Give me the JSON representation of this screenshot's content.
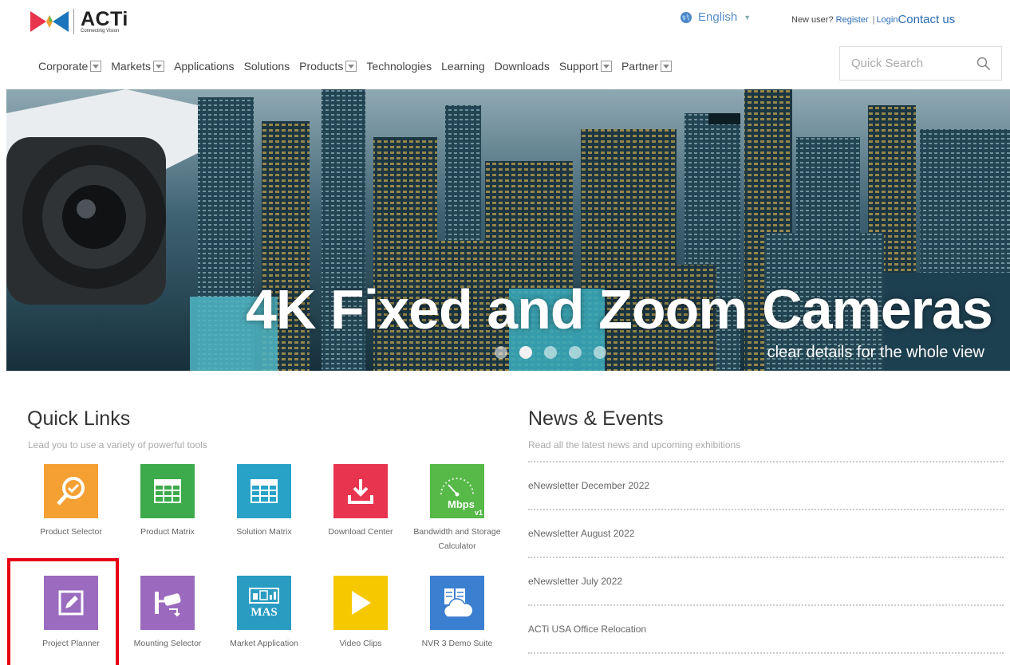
{
  "header": {
    "logo_text": "ACTi",
    "logo_tagline": "Connecting Vision",
    "language": "English",
    "new_user": "New user?",
    "register": "Register",
    "separator": "|",
    "login": "Login",
    "contact": "Contact us"
  },
  "nav": {
    "items": [
      {
        "label": "Corporate",
        "dropdown": true
      },
      {
        "label": "Markets",
        "dropdown": true
      },
      {
        "label": "Applications",
        "dropdown": false
      },
      {
        "label": "Solutions",
        "dropdown": false
      },
      {
        "label": "Products",
        "dropdown": true
      },
      {
        "label": "Technologies",
        "dropdown": false
      },
      {
        "label": "Learning",
        "dropdown": false
      },
      {
        "label": "Downloads",
        "dropdown": false
      },
      {
        "label": "Support",
        "dropdown": true
      },
      {
        "label": "Partner",
        "dropdown": true
      }
    ],
    "search_placeholder": "Quick Search"
  },
  "banner": {
    "title": "4K Fixed and Zoom Cameras",
    "subtitle": "clear details for the whole view",
    "slide_count": 5,
    "active_slide": 2
  },
  "quick_links": {
    "title": "Quick Links",
    "subtitle": "Lead you to use a variety of powerful tools",
    "tiles": [
      {
        "label": "Product Selector",
        "icon": "magnifier-check-icon",
        "color": "#f5a033"
      },
      {
        "label": "Product Matrix",
        "icon": "grid-table-icon",
        "color": "#3daa4b"
      },
      {
        "label": "Solution Matrix",
        "icon": "grid-table-icon",
        "color": "#28a3c7"
      },
      {
        "label": "Download Center",
        "icon": "download-icon",
        "color": "#e8344e"
      },
      {
        "label": "Bandwidth and Storage Calculator",
        "icon": "speedometer-icon",
        "color": "#56b948",
        "icon_text": "Mbps",
        "icon_sub": "v1"
      },
      {
        "label": "Project Planner",
        "icon": "edit-pencil-icon",
        "color": "#9a6bbf"
      },
      {
        "label": "Mounting Selector",
        "icon": "camera-mount-icon",
        "color": "#9b69bd"
      },
      {
        "label": "Market Application",
        "icon": "mas-icon",
        "color": "#2a9cc2",
        "icon_text": "MAS"
      },
      {
        "label": "Video Clips",
        "icon": "play-icon",
        "color": "#f5c800"
      },
      {
        "label": "NVR 3 Demo Suite",
        "icon": "cloud-server-icon",
        "color": "#3b7fd0"
      }
    ]
  },
  "news": {
    "title": "News & Events",
    "subtitle": "Read all the latest news and upcoming exhibitions",
    "items": [
      "eNewsletter December 2022",
      "eNewsletter August 2022",
      "eNewsletter July 2022",
      "ACTi USA Office Relocation"
    ]
  },
  "colors": {
    "link_blue": "#2a6db5",
    "highlight_red": "#e60012"
  }
}
